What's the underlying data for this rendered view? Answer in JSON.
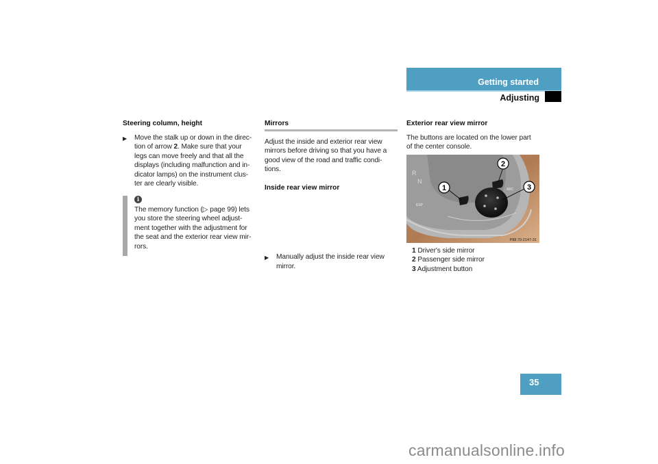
{
  "header": {
    "section": "Getting started",
    "chapter": "Adjusting",
    "accent_color": "#4f9fc2"
  },
  "column1": {
    "heading": "Steering column, height",
    "bullet_icon": "triangle-right",
    "bullet_parts": {
      "before": "Move the stalk up or down in the direc-tion of arrow ",
      "ref": "2",
      "after": ". Make sure that your legs can move freely and that all the displays (including malfunction and in-dicator lamps) on the instrument clus-ter are clearly visible."
    },
    "lines": [
      "Move the stalk up or down in the direc-",
      "tion of arrow ",
      "legs can move freely and that all the",
      "displays (including malfunction and in-",
      "dicator lamps) on the instrument clus-",
      "ter are clearly visible."
    ],
    "line2_ref": "2",
    "line2_after": ". Make sure that your",
    "info": {
      "icon": "info-icon",
      "lines": [
        "The memory function (▷ page 99) lets",
        "you store the steering wheel adjust-",
        "ment together with the adjustment for",
        "the seat and the exterior rear view mir-",
        "rors."
      ]
    }
  },
  "column2": {
    "heading": "Mirrors",
    "intro_lines": [
      "Adjust the inside and exterior rear view",
      "mirrors before driving so that you have a",
      "good view of the road and traffic condi-",
      "tions."
    ],
    "subheading": "Inside rear view mirror",
    "bullet_lines": [
      "Manually adjust the inside rear view",
      "mirror."
    ]
  },
  "column3": {
    "heading": "Exterior rear view mirror",
    "intro_lines": [
      "The buttons are located on the lower part",
      "of the center console."
    ],
    "image": {
      "description": "Center console with mirror adjustment buttons",
      "code": "P88.70-2147-31",
      "callouts": [
        "1",
        "2",
        "3"
      ]
    },
    "legend": [
      {
        "num": "1",
        "label": "Driver's side mirror"
      },
      {
        "num": "2",
        "label": "Passenger side mirror"
      },
      {
        "num": "3",
        "label": "Adjustment button"
      }
    ]
  },
  "page_number": "35",
  "watermark": "carmanualsonline.info"
}
